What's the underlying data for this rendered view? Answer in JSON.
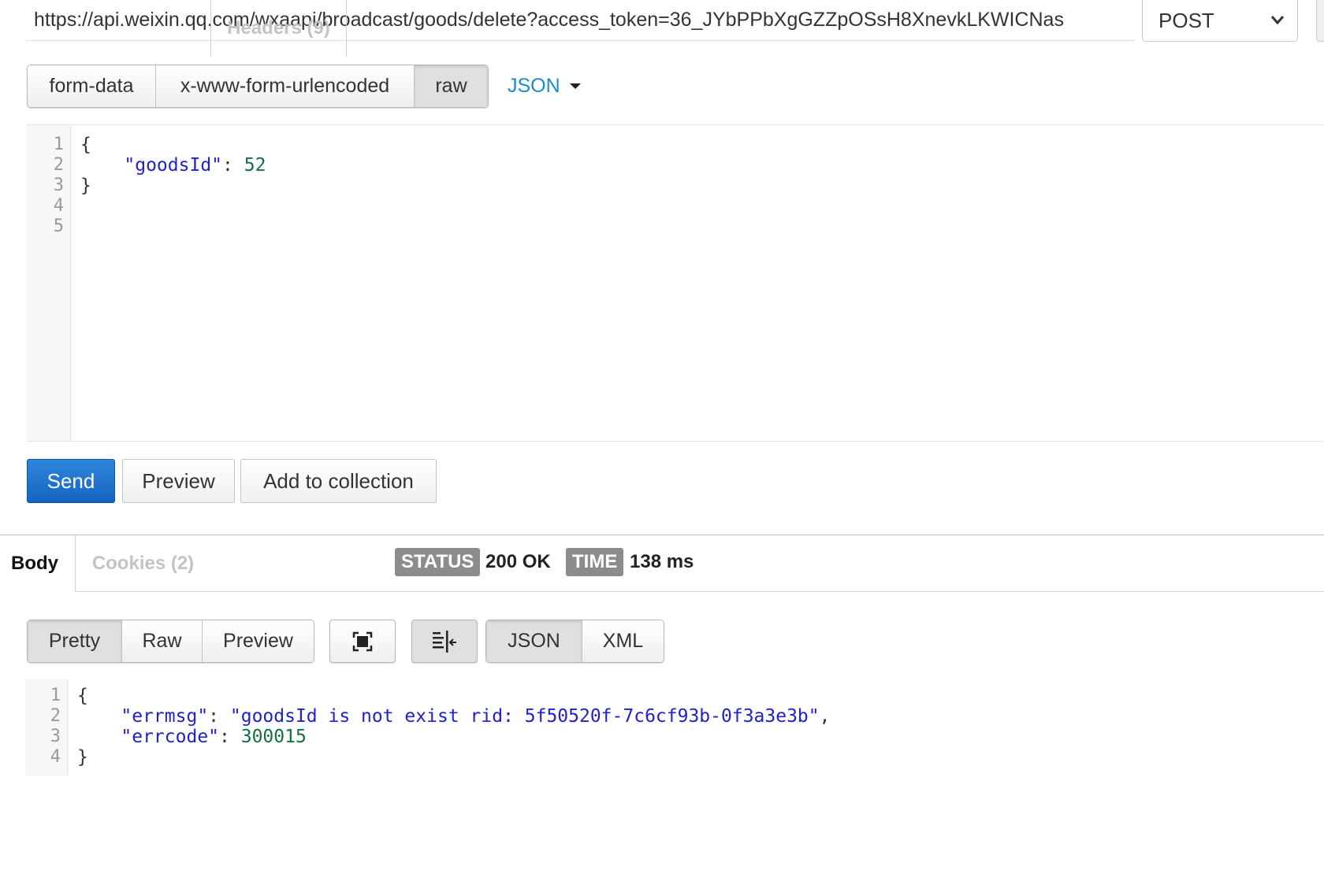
{
  "request": {
    "url": "https://api.weixin.qq.com/wxaapi/broadcast/goods/delete?access_token=36_JYbPPbXgGZZpOSsH8XnevkLKWICNas",
    "method": "POST"
  },
  "body_type_tabs": [
    "form-data",
    "x-www-form-urlencoded",
    "raw"
  ],
  "body_type_active": "raw",
  "body_format": "JSON",
  "request_editor": {
    "line_numbers": [
      "1",
      "2",
      "3",
      "4",
      "5"
    ],
    "body_open": "{",
    "body_key": "\"goodsId\"",
    "body_colon": ": ",
    "body_value": "52",
    "body_close": "}"
  },
  "actions": {
    "send": "Send",
    "preview": "Preview",
    "add_to_collection": "Add to collection"
  },
  "response_tabs": {
    "body": "Body",
    "cookies": "Cookies (2)",
    "headers": "Headers (9)"
  },
  "response_meta": {
    "status_label": "STATUS",
    "status_value": "200 OK",
    "time_label": "TIME",
    "time_value": "138 ms"
  },
  "view_tabs": [
    "Pretty",
    "Raw",
    "Preview"
  ],
  "view_active": "Pretty",
  "icons": {
    "fullscreen": "fullscreen-icon",
    "wrap": "wrap-lines-icon",
    "method_chevron": "chevron-down-icon",
    "format_caret": "caret-down-icon"
  },
  "lang_tabs": [
    "JSON",
    "XML"
  ],
  "lang_active": "JSON",
  "response_editor": {
    "line_numbers": [
      "1",
      "2",
      "3",
      "4"
    ],
    "open": "{",
    "errmsg_key": "\"errmsg\"",
    "errmsg_value": "\"goodsId is not exist rid: 5f50520f-7c6cf93b-0f3a3e3b\"",
    "errcode_key": "\"errcode\"",
    "errcode_value": "300015",
    "close": "}"
  },
  "colors": {
    "accent_link": "#1a8bd1",
    "send_button": "#1565c0",
    "json_key": "#2020d0",
    "json_number": "#107040",
    "badge": "#8c8c8c"
  }
}
